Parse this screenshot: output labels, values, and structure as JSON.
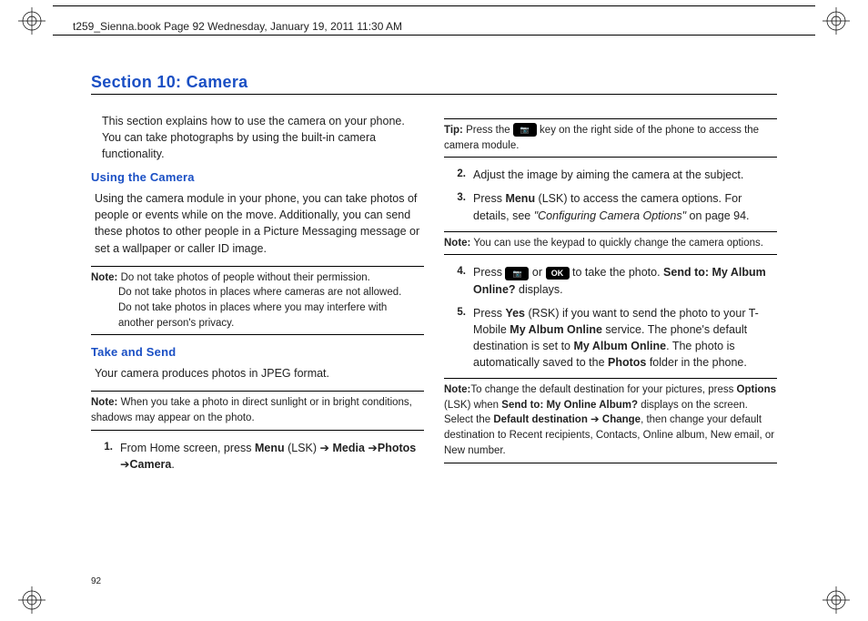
{
  "header": "t259_Sienna.book  Page 92  Wednesday, January 19, 2011  11:30 AM",
  "section_title": "Section 10: Camera",
  "page_number": "92",
  "left": {
    "intro": "This section explains how to use the camera on your phone. You can take photographs by using the built-in camera functionality.",
    "h1": "Using the Camera",
    "p1": "Using the camera module in your phone, you can take photos of people or events while on the move. Additionally, you can send these photos to other people in a Picture Messaging message or set a wallpaper or caller ID image.",
    "note1_label": "Note:",
    "note1_l1": "Do not take photos of people without their permission.",
    "note1_l2": "Do not take photos in places where cameras are not allowed.",
    "note1_l3": "Do not take photos in places where you may interfere with another person's privacy.",
    "h2": "Take and Send",
    "p2": "Your camera produces photos in JPEG format.",
    "note2_label": "Note:",
    "note2": "When you take a photo in direct sunlight or in bright conditions, shadows may appear on the photo.",
    "step1_num": "1.",
    "step1_a": "From Home screen, press ",
    "step1_menu": "Menu",
    "step1_b": " (LSK) ",
    "step1_arrow": "➔",
    "step1_media": " Media ",
    "step1_photos": "Photos ",
    "step1_camera": "Camera",
    "step1_dot": "."
  },
  "right": {
    "tip_label": "Tip:",
    "tip_a": "Press the ",
    "tip_b": " key on the right side of the phone to access the camera module.",
    "step2_num": "2.",
    "step2": "Adjust the image by aiming the camera at the subject.",
    "step3_num": "3.",
    "step3_a": "Press ",
    "step3_menu": "Menu",
    "step3_b": " (LSK) to access the camera options. For details, see ",
    "step3_ref": "\"Configuring Camera Options\"",
    "step3_c": " on page 94.",
    "note3_label": "Note:",
    "note3": " You can use the keypad to quickly change the camera options.",
    "step4_num": "4.",
    "step4_a": "Press ",
    "step4_or": " or ",
    "step4_ok": "OK",
    "step4_b": " to take the photo. ",
    "step4_bold": "Send to: My Album Online?",
    "step4_c": " displays.",
    "step5_num": "5.",
    "step5_a": "Press ",
    "step5_yes": "Yes",
    "step5_b": " (RSK) if you want to send the photo to your T-Mobile ",
    "step5_bold1": "My Album Online",
    "step5_c": " service. The phone's default destination is set to ",
    "step5_bold2": "My Album Online",
    "step5_d": ". The photo is automatically saved to the ",
    "step5_bold3": "Photos",
    "step5_e": " folder in the phone.",
    "note4_label": "Note:",
    "note4_a": "To change the default destination for your pictures, press ",
    "note4_w1": "Options",
    "note4_b": " (LSK) when ",
    "note4_w2": "Send to: My Online Album?",
    "note4_c": " displays on the screen. Select the ",
    "note4_w3": "Default destination",
    "note4_arrow": " ➔ ",
    "note4_w4": "Change",
    "note4_d": ", then change your default destination to Recent recipients, Contacts, Online album, New email, or New number."
  }
}
